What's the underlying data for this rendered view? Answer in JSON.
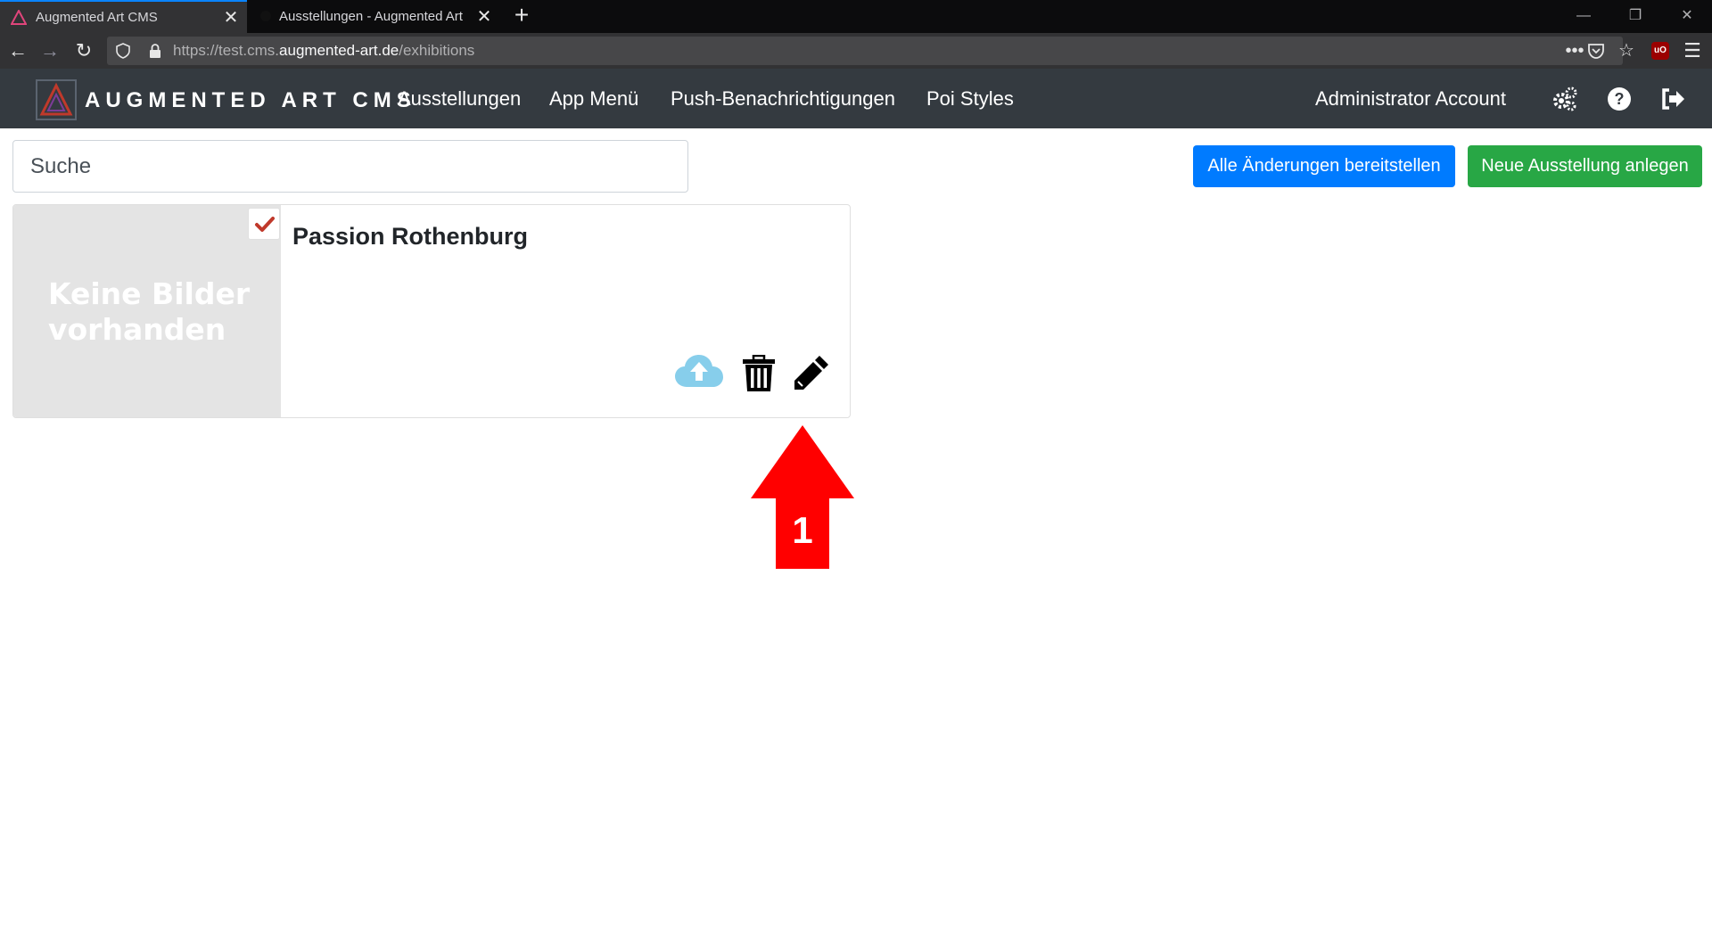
{
  "browser": {
    "tabs": [
      {
        "title": "Augmented Art CMS",
        "active": true
      },
      {
        "title": "Ausstellungen - Augmented Art",
        "active": false
      }
    ],
    "url": {
      "prefix": "https://test.cms.",
      "domain": "augmented-art.de",
      "path": "/exhibitions"
    },
    "icons": [
      "back-icon",
      "forward-icon",
      "reload-icon",
      "shield-icon",
      "lock-icon",
      "more-icon",
      "pocket-icon",
      "bookmark-star-icon",
      "ublock-icon",
      "menu-icon"
    ],
    "ublock_label": "uO"
  },
  "header": {
    "brand": "AUGMENTED ART CMS",
    "nav": [
      "Ausstellungen",
      "App Menü",
      "Push-Benachrichtigungen",
      "Poi Styles"
    ],
    "account": "Administrator Account",
    "icons": [
      "settings-icon",
      "help-icon",
      "logout-icon"
    ],
    "colors": {
      "bar": "#343a40",
      "logo_accent": "#c0392b"
    }
  },
  "toolbar": {
    "search_placeholder": "Suche",
    "deploy_button": "Alle Änderungen bereitstellen",
    "new_button": "Neue Ausstellung anlegen",
    "colors": {
      "deploy": "#007bff",
      "new": "#28a745"
    }
  },
  "exhibition": {
    "title": "Passion Rothenburg",
    "no_images": "Keine Bilder vorhanden",
    "checked": true,
    "actions": [
      "upload-cloud-icon",
      "trash-icon",
      "edit-pencil-icon"
    ],
    "colors": {
      "check": "#c0392b",
      "cloud": "#87ceeb"
    }
  },
  "annotation": {
    "label": "1",
    "color": "#ff0000"
  }
}
